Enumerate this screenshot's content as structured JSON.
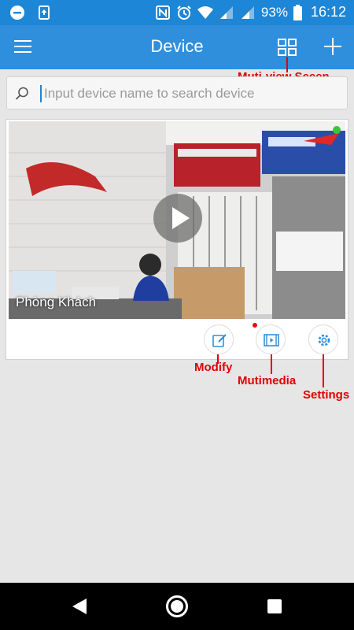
{
  "status_bar": {
    "battery": "93%",
    "time": "16:12",
    "icons": [
      "minus-circle-icon",
      "upload-icon",
      "nfc-icon",
      "alarm-icon",
      "wifi-icon",
      "signal-icon",
      "signal-icon",
      "battery-icon"
    ]
  },
  "app_bar": {
    "title": "Device",
    "icons": [
      "menu-icon",
      "multi-view-icon",
      "add-icon"
    ]
  },
  "search": {
    "placeholder": "Input device name to search device",
    "value": ""
  },
  "device": {
    "name": "Phòng Khách",
    "status_color": "#3cc43c",
    "actions": [
      "edit-icon",
      "media-icon",
      "gear-icon"
    ]
  },
  "annotations": {
    "multi_view": "Muti-view Sceen",
    "modify": "Modify",
    "multimedia": "Mutimedia",
    "settings": "Settings"
  },
  "colors": {
    "app_bar": "#2f8fdd",
    "status_bar": "#1d86d6",
    "annotation": "#e00000"
  }
}
